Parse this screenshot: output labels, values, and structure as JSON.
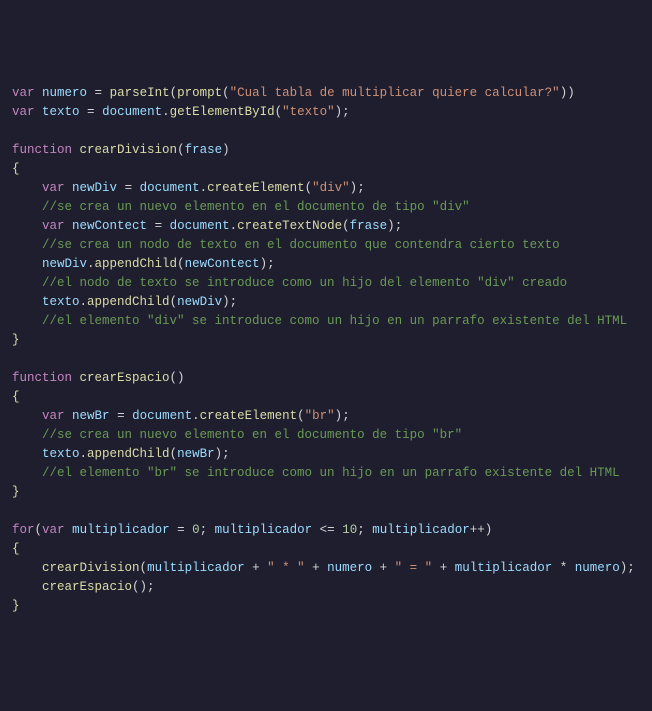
{
  "code": {
    "l1_var": "var",
    "l1_numero": "numero",
    "l1_eq": " = ",
    "l1_parseInt": "parseInt",
    "l1_prompt": "prompt",
    "l1_str": "\"Cual tabla de multiplicar quiere calcular?\"",
    "l2_var": "var",
    "l2_texto": "texto",
    "l2_eq": " = ",
    "l2_document": "document",
    "l2_getElementById": "getElementById",
    "l2_str": "\"texto\"",
    "l4_function": "function",
    "l4_name": "crearDivision",
    "l4_param": "frase",
    "l6_var": "var",
    "l6_newDiv": "newDiv",
    "l6_eq": " = ",
    "l6_document": "document",
    "l6_createElement": "createElement",
    "l6_str": "\"div\"",
    "l7_comment": "//se crea un nuevo elemento en el documento de tipo \"div\"",
    "l8_var": "var",
    "l8_newContect": "newContect",
    "l8_eq": " = ",
    "l8_document": "document",
    "l8_createTextNode": "createTextNode",
    "l8_frase": "frase",
    "l9_comment": "//se crea un nodo de texto en el documento que contendra cierto texto",
    "l10_newDiv": "newDiv",
    "l10_appendChild": "appendChild",
    "l10_newContect": "newContect",
    "l11_comment": "//el nodo de texto se introduce como un hijo del elemento \"div\" creado",
    "l12_texto": "texto",
    "l12_appendChild": "appendChild",
    "l12_newDiv": "newDiv",
    "l13_comment": "//el elemento \"div\" se introduce como un hijo en un parrafo existente del HTML",
    "l16_function": "function",
    "l16_name": "crearEspacio",
    "l18_var": "var",
    "l18_newBr": "newBr",
    "l18_eq": " = ",
    "l18_document": "document",
    "l18_createElement": "createElement",
    "l18_str": "\"br\"",
    "l19_comment": "//se crea un nuevo elemento en el documento de tipo \"br\"",
    "l20_texto": "texto",
    "l20_appendChild": "appendChild",
    "l20_newBr": "newBr",
    "l21_comment": "//el elemento \"br\" se introduce como un hijo en un parrafo existente del HTML",
    "l24_for": "for",
    "l24_var": "var",
    "l24_mult": "multiplicador",
    "l24_eq": " = ",
    "l24_zero": "0",
    "l24_semi1": "; ",
    "l24_mult2": "multiplicador",
    "l24_lte": " <= ",
    "l24_ten": "10",
    "l24_semi2": "; ",
    "l24_mult3": "multiplicador",
    "l24_inc": "++",
    "l26_crearDivision": "crearDivision",
    "l26_mult": "multiplicador",
    "l26_p1": " + ",
    "l26_s1": "\" * \"",
    "l26_p2": " + ",
    "l26_numero": "numero",
    "l26_p3": " + ",
    "l26_s2": "\" = \"",
    "l26_p4": " + ",
    "l26_mult2": "multiplicador",
    "l26_times": " * ",
    "l26_numero2": "numero",
    "l27_crearEspacio": "crearEspacio"
  }
}
